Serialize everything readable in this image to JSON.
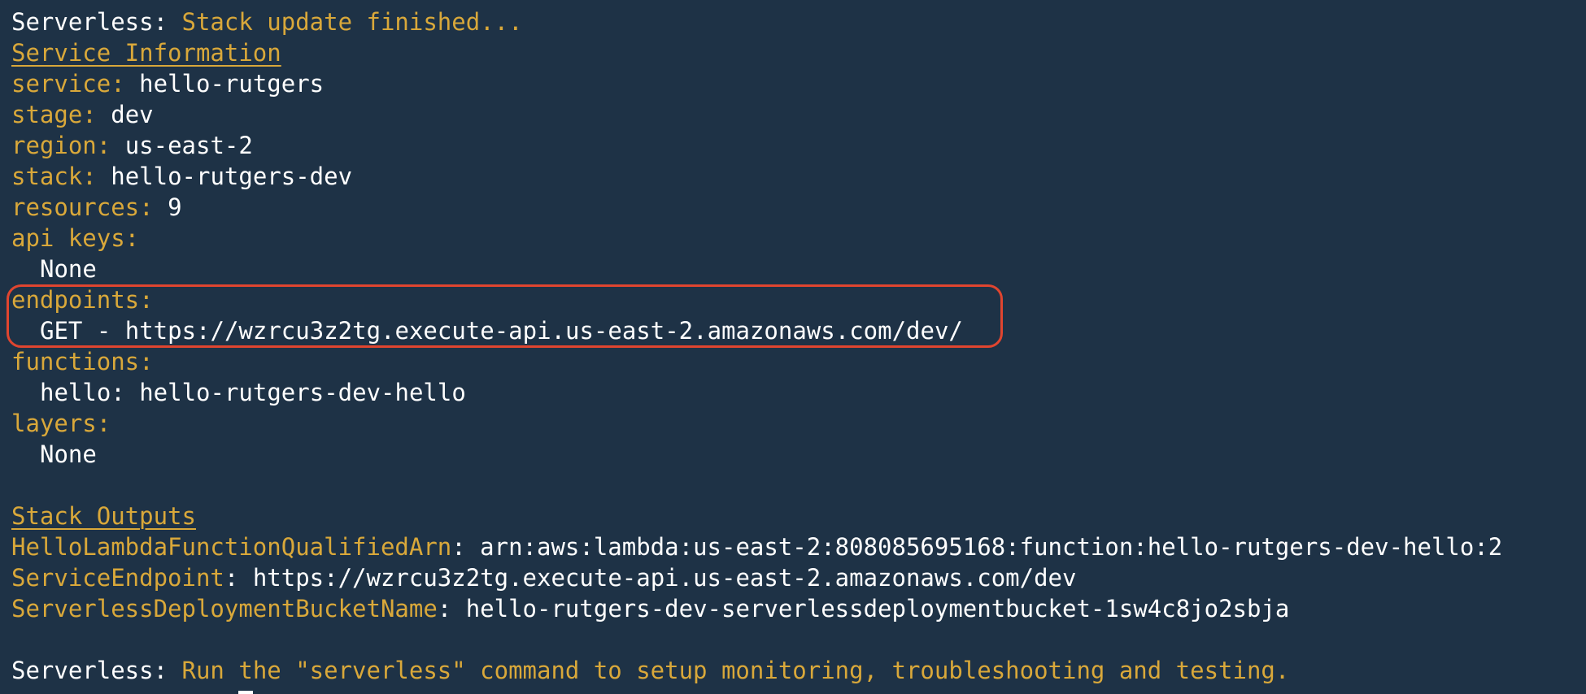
{
  "header": {
    "prefix": "Serverless: ",
    "message": "Stack update finished..."
  },
  "service_info": {
    "heading": "Service Information",
    "service_key": "service:",
    "service_value": "hello-rutgers",
    "stage_key": "stage:",
    "stage_value": "dev",
    "region_key": "region:",
    "region_value": "us-east-2",
    "stack_key": "stack:",
    "stack_value": "hello-rutgers-dev",
    "resources_key": "resources:",
    "resources_value": "9",
    "api_keys_key": "api keys:",
    "api_keys_value": "None",
    "endpoints_key": "endpoints:",
    "endpoint_value": "GET - https://wzrcu3z2tg.execute-api.us-east-2.amazonaws.com/dev/",
    "functions_key": "functions:",
    "function_value": "hello: hello-rutgers-dev-hello",
    "layers_key": "layers:",
    "layers_value": "None"
  },
  "stack_outputs": {
    "heading": "Stack Outputs",
    "outputs": [
      {
        "key": "HelloLambdaFunctionQualifiedArn",
        "value": "arn:aws:lambda:us-east-2:808085695168:function:hello-rutgers-dev-hello:2"
      },
      {
        "key": "ServiceEndpoint",
        "value": "https://wzrcu3z2tg.execute-api.us-east-2.amazonaws.com/dev"
      },
      {
        "key": "ServerlessDeploymentBucketName",
        "value": "hello-rutgers-dev-serverlessdeploymentbucket-1sw4c8jo2sbja"
      }
    ]
  },
  "footer": {
    "prefix": "Serverless: ",
    "message": "Run the \"serverless\" command to setup monitoring, troubleshooting and testing."
  },
  "colors": {
    "background": "#1e3246",
    "key_yellow": "#d9a83a",
    "value_white": "#ffffff",
    "highlight_red": "#e0452f"
  }
}
